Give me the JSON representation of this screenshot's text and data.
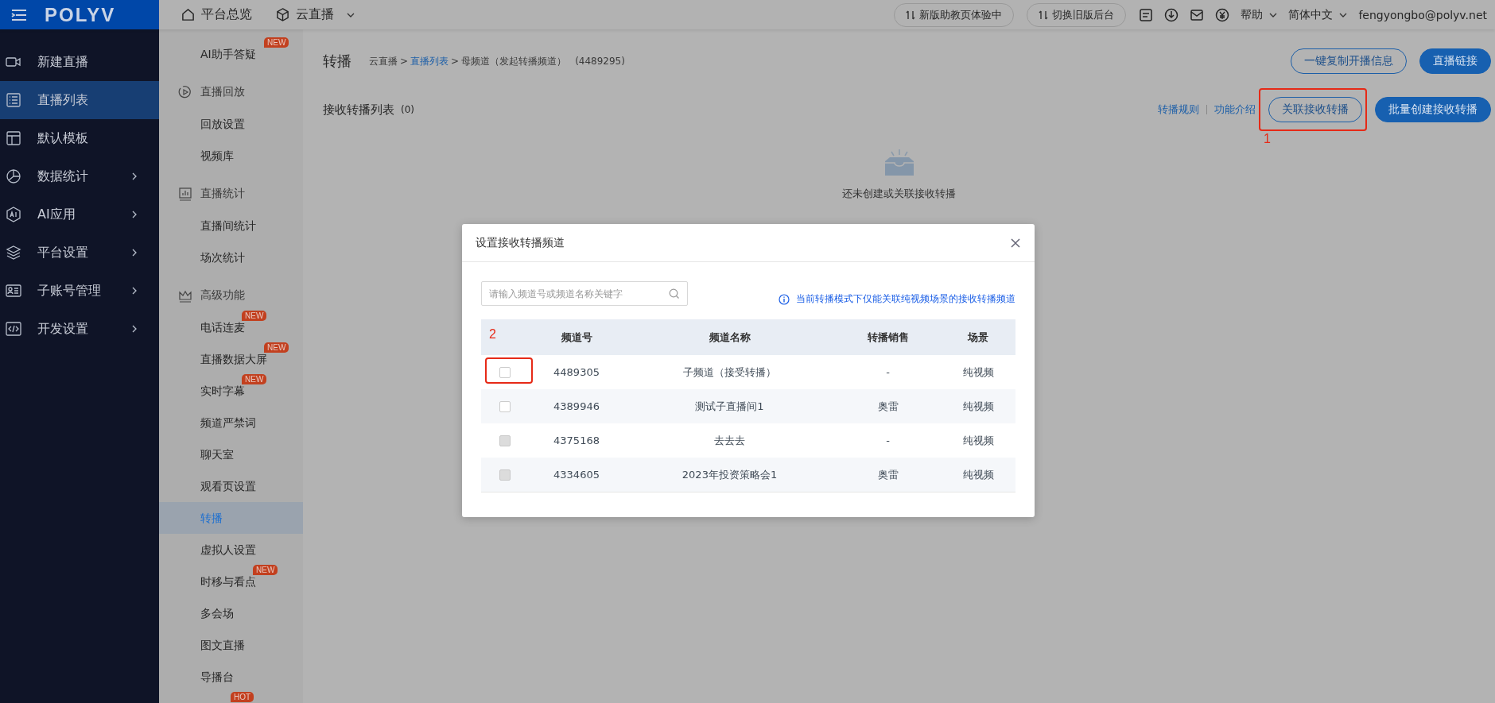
{
  "topbar": {
    "logo": "POLYV",
    "nav": [
      {
        "label": "平台总览",
        "dropdown": false
      },
      {
        "label": "云直播",
        "dropdown": true
      }
    ],
    "pills": [
      "新版助教页体验中",
      "切换旧版后台"
    ],
    "help": "帮助",
    "language": "简体中文",
    "user": "fengyongbo@polyv.net"
  },
  "sidebar": {
    "items": [
      {
        "label": "新建直播",
        "selected": false,
        "expandable": false
      },
      {
        "label": "直播列表",
        "selected": true,
        "expandable": false
      },
      {
        "label": "默认模板",
        "selected": false,
        "expandable": false
      },
      {
        "label": "数据统计",
        "selected": false,
        "expandable": true
      },
      {
        "label": "AI应用",
        "selected": false,
        "expandable": true
      },
      {
        "label": "平台设置",
        "selected": false,
        "expandable": true
      },
      {
        "label": "子账号管理",
        "selected": false,
        "expandable": true
      },
      {
        "label": "开发设置",
        "selected": false,
        "expandable": true
      }
    ]
  },
  "subnav": [
    {
      "kind": "item",
      "label": "AI助手答疑",
      "badge": "NEW",
      "selected": false
    },
    {
      "kind": "group",
      "label": "直播回放"
    },
    {
      "kind": "item",
      "label": "回放设置",
      "selected": false
    },
    {
      "kind": "item",
      "label": "视频库",
      "selected": false
    },
    {
      "kind": "group",
      "label": "直播统计"
    },
    {
      "kind": "item",
      "label": "直播间统计",
      "selected": false
    },
    {
      "kind": "item",
      "label": "场次统计",
      "selected": false
    },
    {
      "kind": "group",
      "label": "高级功能"
    },
    {
      "kind": "item",
      "label": "电话连麦",
      "badge": "NEW",
      "selected": false
    },
    {
      "kind": "item",
      "label": "直播数据大屏",
      "badge": "NEW",
      "selected": false
    },
    {
      "kind": "item",
      "label": "实时字幕",
      "badge": "NEW",
      "selected": false
    },
    {
      "kind": "item",
      "label": "频道严禁词",
      "selected": false
    },
    {
      "kind": "item",
      "label": "聊天室",
      "selected": false
    },
    {
      "kind": "item",
      "label": "观看页设置",
      "selected": false
    },
    {
      "kind": "item",
      "label": "转播",
      "selected": true
    },
    {
      "kind": "item",
      "label": "虚拟人设置",
      "selected": false
    },
    {
      "kind": "item",
      "label": "时移与看点",
      "badge": "NEW",
      "selected": false
    },
    {
      "kind": "item",
      "label": "多会场",
      "selected": false
    },
    {
      "kind": "item",
      "label": "图文直播",
      "selected": false
    },
    {
      "kind": "item",
      "label": "导播台",
      "selected": false
    },
    {
      "kind": "item",
      "badge": "HOT"
    }
  ],
  "page": {
    "title": "转播",
    "breadcrumb": {
      "separator": ">",
      "items": [
        {
          "label": "云直播",
          "link": false
        },
        {
          "label": "直播列表",
          "link": true
        },
        {
          "label": "母频道（发起转播频道）",
          "link": false
        }
      ]
    },
    "channel_id": "(4489295)",
    "actions": [
      {
        "label": "一键复制开播信息",
        "kind": "outline"
      },
      {
        "label": "直播链接",
        "kind": "primary"
      }
    ]
  },
  "list": {
    "title": "接收转播列表",
    "count": "(0)",
    "links": [
      "转播规则",
      "功能介绍"
    ],
    "buttons": [
      {
        "label": "关联接收转播",
        "kind": "outline",
        "annotation": "1"
      },
      {
        "label": "批量创建接收转播",
        "kind": "primary"
      }
    ],
    "empty_text": "还未创建或关联接收转播"
  },
  "modal": {
    "title": "设置接收转播频道",
    "search": {
      "placeholder": "请输入频道号或频道名称关键字"
    },
    "notice": "当前转播模式下仅能关联纯视频场景的接收转播频道",
    "table": {
      "annotation": "2",
      "columns": [
        "频道号",
        "频道名称",
        "转播销售",
        "场景"
      ],
      "rows": [
        {
          "checked": false,
          "disabled": false,
          "annotated": true,
          "cells": [
            "4489305",
            "子频道（接受转播）",
            "-",
            "纯视频"
          ]
        },
        {
          "checked": false,
          "disabled": false,
          "annotated": false,
          "cells": [
            "4389946",
            "测试子直播间1",
            "奥雷",
            "纯视频"
          ]
        },
        {
          "checked": false,
          "disabled": true,
          "annotated": false,
          "cells": [
            "4375168",
            "去去去",
            "-",
            "纯视频"
          ]
        },
        {
          "checked": false,
          "disabled": true,
          "annotated": false,
          "cells": [
            "4334605",
            "2023年投资策略会1",
            "奥雷",
            "纯视频"
          ]
        }
      ]
    }
  }
}
